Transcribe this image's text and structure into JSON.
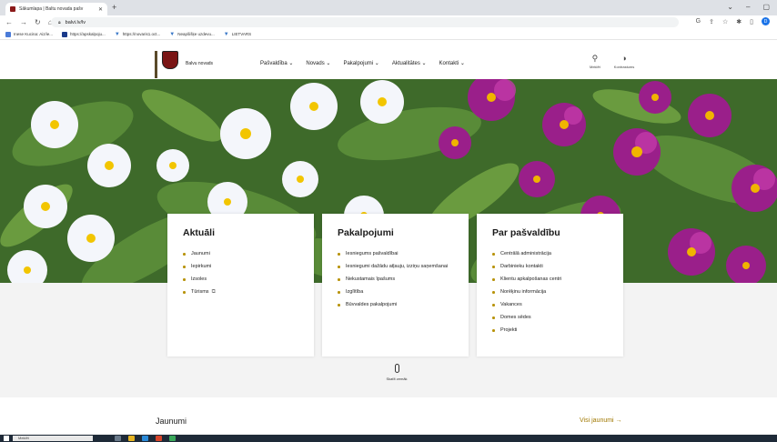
{
  "browser": {
    "tab_title": "Sākumlapa | Baltu novada pašv",
    "tab_close": "✕",
    "new_tab": "+",
    "window_controls": [
      "⌄",
      "–",
      "▢"
    ],
    "url": "balvi.lv/lv",
    "bookmarks": [
      {
        "label": "Inese Kucina: Aiz/ie...",
        "color": "#4a7bd8"
      },
      {
        "label": "https://apskalpoju...",
        "color": "#1a3a8a"
      },
      {
        "label": "https://novaris1.oct...",
        "color": "#3a78c8"
      },
      {
        "label": "Neapšišķe uzdevu...",
        "color": "#3a78c8"
      },
      {
        "label": "LIETVARS",
        "color": "#3a78c8"
      }
    ],
    "profile_initial": "D"
  },
  "header": {
    "logo_text": "Balvu novads",
    "menu": [
      "Pašvaldība ⌄",
      "Novads ⌄",
      "Pakalpojumi ⌄",
      "Aktualitātes ⌄",
      "Kontakti ⌄"
    ],
    "search_label": "Meklēt",
    "contrast_label": "Kontrastums"
  },
  "cards": [
    {
      "title": "Aktuāli",
      "items": [
        "Jaunumi",
        "Iepirkumi",
        "Izsoles",
        "Tūrisms"
      ]
    },
    {
      "title": "Pakalpojumi",
      "items": [
        "Iesniegums pašvaldībai",
        "Iesniegumi dažādu atļauju, izziņu saņemšanai",
        "Nekustamais īpašums",
        "Izglītība",
        "Būvvaldes pakalpojumi"
      ]
    },
    {
      "title": "Par pašvaldību",
      "items": [
        "Centrālā administrācija",
        "Darbinieku kontakti",
        "Klientu apkalpošanas centri",
        "Norēķinu informācija",
        "Vakances",
        "Domes sēdes",
        "Projekti"
      ]
    }
  ],
  "scroll_label": "Skatīt zemāk",
  "news": {
    "title": "Jaunumi",
    "all_link": "Visi jaunumi →"
  },
  "taskbar": {
    "search_placeholder": "Meklēt"
  },
  "colors": {
    "accent": "#b8930a",
    "brand": "#7a1515"
  }
}
